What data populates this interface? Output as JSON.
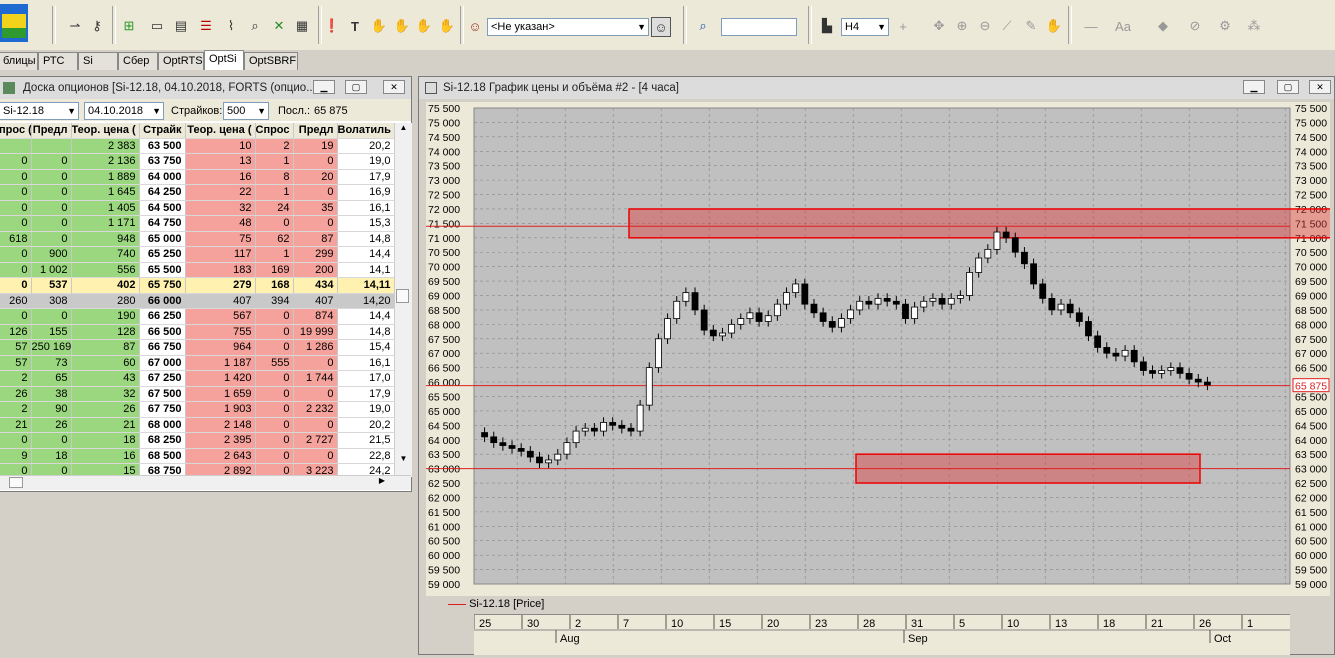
{
  "toolbar": {
    "trader_select": "<Не указан>",
    "timeframe": "H4",
    "search_value": ""
  },
  "tabs": [
    {
      "label": "блицы"
    },
    {
      "label": "РТС"
    },
    {
      "label": "Si"
    },
    {
      "label": "Сбер"
    },
    {
      "label": "OptRTS"
    },
    {
      "label": "OptSi"
    },
    {
      "label": "OptSBRF"
    }
  ],
  "options_window": {
    "title": "Доска опционов [Si-12.18, 04.10.2018, FORTS (опцио...",
    "instrument": "Si-12.18",
    "date": "04.10.2018",
    "strikes_label": "Страйков:",
    "strikes_value": "500",
    "last_label": "Посл.:",
    "last_value": "65 875",
    "headers": [
      "прос (",
      "Предл",
      "Теор. цена (",
      "Страйк",
      "Теор. цена (",
      "Спрос (",
      "Предл",
      "Волатиль"
    ],
    "rows": [
      [
        "",
        "",
        "2 383",
        "63 500",
        "10",
        "2",
        "19",
        "20,2"
      ],
      [
        "0",
        "0",
        "2 136",
        "63 750",
        "13",
        "1",
        "0",
        "19,0"
      ],
      [
        "0",
        "0",
        "1 889",
        "64 000",
        "16",
        "8",
        "20",
        "17,9"
      ],
      [
        "0",
        "0",
        "1 645",
        "64 250",
        "22",
        "1",
        "0",
        "16,9"
      ],
      [
        "0",
        "0",
        "1 405",
        "64 500",
        "32",
        "24",
        "35",
        "16,1"
      ],
      [
        "0",
        "0",
        "1 171",
        "64 750",
        "48",
        "0",
        "0",
        "15,3"
      ],
      [
        "618",
        "0",
        "948",
        "65 000",
        "75",
        "62",
        "87",
        "14,8"
      ],
      [
        "0",
        "900",
        "740",
        "65 250",
        "117",
        "1",
        "299",
        "14,4"
      ],
      [
        "0",
        "1 002",
        "556",
        "65 500",
        "183",
        "169",
        "200",
        "14,1"
      ],
      [
        "0",
        "537",
        "402",
        "65 750",
        "279",
        "168",
        "434",
        "14,11"
      ],
      [
        "260",
        "308",
        "280",
        "66 000",
        "407",
        "394",
        "407",
        "14,20"
      ],
      [
        "0",
        "0",
        "190",
        "66 250",
        "567",
        "0",
        "874",
        "14,4"
      ],
      [
        "126",
        "155",
        "128",
        "66 500",
        "755",
        "0",
        "19 999",
        "14,8"
      ],
      [
        "57",
        "250 169",
        "87",
        "66 750",
        "964",
        "0",
        "1 286",
        "15,4"
      ],
      [
        "57",
        "73",
        "60",
        "67 000",
        "1 187",
        "555",
        "0",
        "16,1"
      ],
      [
        "2",
        "65",
        "43",
        "67 250",
        "1 420",
        "0",
        "1 744",
        "17,0"
      ],
      [
        "26",
        "38",
        "32",
        "67 500",
        "1 659",
        "0",
        "0",
        "17,9"
      ],
      [
        "2",
        "90",
        "26",
        "67 750",
        "1 903",
        "0",
        "2 232",
        "19,0"
      ],
      [
        "21",
        "26",
        "21",
        "68 000",
        "2 148",
        "0",
        "0",
        "20,2"
      ],
      [
        "0",
        "0",
        "18",
        "68 250",
        "2 395",
        "0",
        "2 727",
        "21,5"
      ],
      [
        "9",
        "18",
        "16",
        "68 500",
        "2 643",
        "0",
        "0",
        "22,8"
      ],
      [
        "0",
        "0",
        "15",
        "68 750",
        "2 892",
        "0",
        "3 223",
        "24,2"
      ]
    ]
  },
  "chart_window": {
    "title": "Si-12.18 График цены и объёма #2 - [4 часа]",
    "legend": "Si-12.18 [Price]",
    "current_price_label": "65 875"
  },
  "chart_data": {
    "type": "candlestick",
    "series": [
      {
        "name": "Si-12.18 [Price]"
      }
    ],
    "ylim": [
      59000,
      75500
    ],
    "y_ticks": [
      "75 500",
      "75 000",
      "74 500",
      "74 000",
      "73 500",
      "73 000",
      "72 500",
      "72 000",
      "71 500",
      "71 000",
      "70 500",
      "70 000",
      "69 500",
      "69 000",
      "68 500",
      "68 000",
      "67 500",
      "67 000",
      "66 500",
      "66 000",
      "65 500",
      "65 000",
      "64 500",
      "64 000",
      "63 500",
      "63 000",
      "62 500",
      "62 000",
      "61 500",
      "61 000",
      "60 500",
      "60 000",
      "59 500",
      "59 000"
    ],
    "x_day_labels": [
      "25",
      "30",
      "2",
      "7",
      "10",
      "15",
      "20",
      "23",
      "28",
      "31",
      "5",
      "10",
      "13",
      "18",
      "21",
      "26",
      "1"
    ],
    "x_month_labels": [
      "Aug",
      "Sep",
      "Oct"
    ],
    "horizontal_lines": [
      71400,
      65875,
      63000
    ],
    "zones": [
      {
        "from": 71000,
        "to": 72000
      },
      {
        "from": 62500,
        "to": 63500
      }
    ],
    "closes": [
      64100,
      63900,
      63800,
      63700,
      63600,
      63400,
      63200,
      63300,
      63500,
      63900,
      64300,
      64400,
      64300,
      64600,
      64500,
      64400,
      64300,
      65200,
      66500,
      67500,
      68200,
      68800,
      69100,
      68500,
      67800,
      67600,
      67700,
      68000,
      68200,
      68400,
      68100,
      68300,
      68700,
      69100,
      69400,
      68700,
      68400,
      68100,
      67900,
      68200,
      68500,
      68800,
      68700,
      68900,
      68800,
      68700,
      68200,
      68600,
      68800,
      68900,
      68700,
      68900,
      69000,
      69800,
      70300,
      70600,
      71200,
      71000,
      70500,
      70100,
      69400,
      68900,
      68500,
      68700,
      68400,
      68100,
      67600,
      67200,
      67000,
      66900,
      67100,
      66700,
      66400,
      66300,
      66400,
      66500,
      66300,
      66100,
      66000,
      65900
    ]
  },
  "colors": {
    "call_bg": "#9ad77e",
    "put_bg": "#f5a29c",
    "highlight_row": "#fff2b0",
    "current_row": "#c9c9c9",
    "chart_bg": "#c0c0c0",
    "price_line": "#e02020"
  }
}
